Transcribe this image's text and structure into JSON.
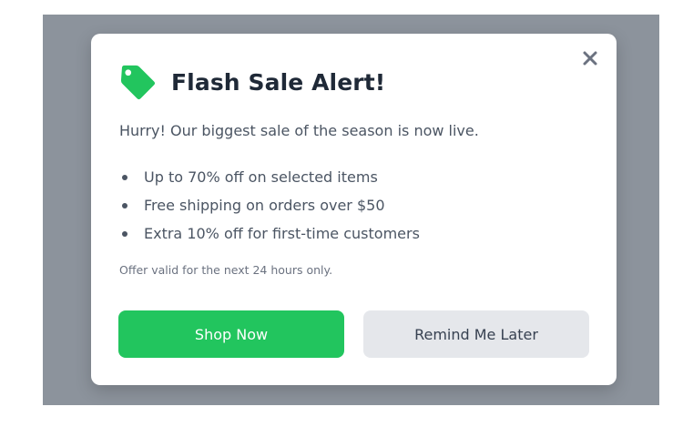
{
  "modal": {
    "title": "Flash Sale Alert!",
    "intro": "Hurry! Our biggest sale of the season is now live.",
    "features": [
      "Up to 70% off on selected items",
      "Free shipping on orders over $50",
      "Extra 10% off for first-time customers"
    ],
    "note": "Offer valid for the next 24 hours only.",
    "icons": {
      "header": "tag-icon",
      "close": "close-icon"
    }
  },
  "actions": {
    "primary_label": "Shop Now",
    "secondary_label": "Remind Me Later"
  },
  "colors": {
    "overlay": "#8c939c",
    "accent": "#22c55e",
    "secondary_button": "#e5e7eb"
  }
}
